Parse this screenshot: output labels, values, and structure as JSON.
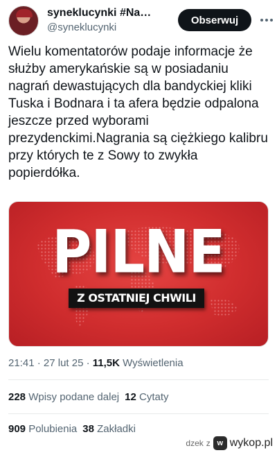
{
  "author": {
    "display_name": "syneklucynki #Na…",
    "handle": "@syneklucynki"
  },
  "follow_label": "Obserwuj",
  "tweet_text": "Wielu komentatorów podaje informacje że służby amerykańskie są w posiadaniu nagrań dewastujących dla bandyckiej kliki Tuska i Bodnara i ta afera będzie odpalona jeszcze przed wyborami prezydenckimi.Nagrania są ciężkiego kalibru przy których te z Sowy to zwykła popierdółka.",
  "media": {
    "headline": "PILNE",
    "banner": "Z OSTATNIEJ CHWILI",
    "background_color": "#d63434"
  },
  "meta": {
    "time": "21:41",
    "separator1": " · ",
    "date": "27 lut 25",
    "separator2": " · ",
    "views_count": "11,5K",
    "views_label": "Wyświetlenia"
  },
  "stats_row1": {
    "reposts_count": "228",
    "reposts_label": "Wpisy podane dalej",
    "quotes_count": "12",
    "quotes_label": "Cytaty"
  },
  "stats_row2": {
    "likes_count": "909",
    "likes_label": "Polubienia",
    "bookmarks_count": "38",
    "bookmarks_label": "Zakładki"
  },
  "watermark": {
    "user": "dzek",
    "prep": "z",
    "site": "wykop.pl"
  },
  "colors": {
    "text": "#0f1419",
    "secondary": "#536471",
    "follow_bg": "#0f1419"
  }
}
